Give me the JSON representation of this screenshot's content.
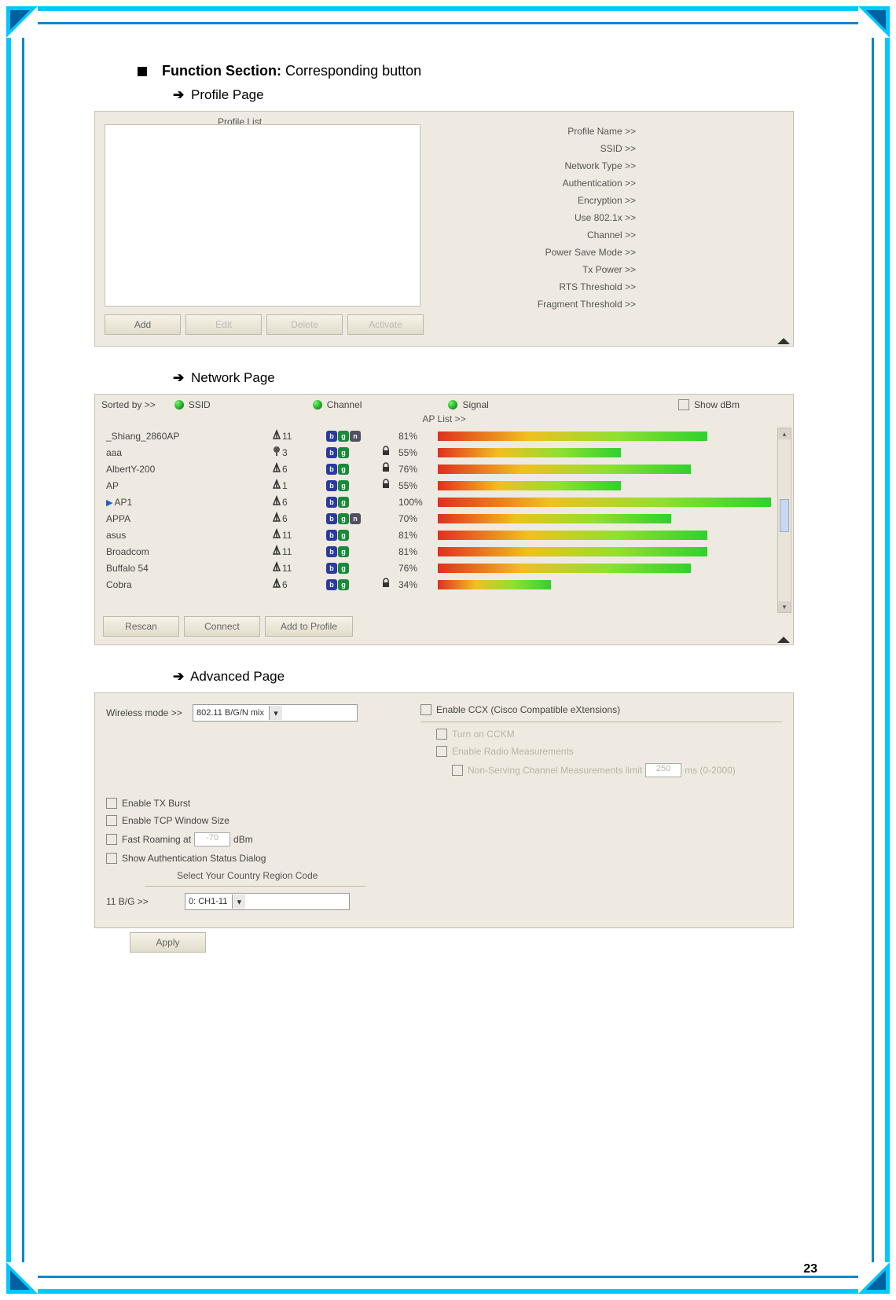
{
  "heading": {
    "label": "Function Section:",
    "desc": "Corresponding button"
  },
  "profile": {
    "title": "Profile Page",
    "list_title": "Profile List",
    "buttons": {
      "add": "Add",
      "edit": "Edit",
      "delete": "Delete",
      "activate": "Activate"
    },
    "props": [
      "Profile Name >>",
      "SSID >>",
      "Network Type >>",
      "Authentication >>",
      "Encryption >>",
      "Use 802.1x >>",
      "Channel >>",
      "Power Save Mode >>",
      "Tx Power >>",
      "RTS Threshold >>",
      "Fragment Threshold >>"
    ]
  },
  "network": {
    "title": "Network Page",
    "sorted_by": "Sorted by >>",
    "ssid": "SSID",
    "channel": "Channel",
    "signal": "Signal",
    "show_dbm": "Show dBm",
    "aplist": "AP List >>",
    "buttons": {
      "rescan": "Rescan",
      "connect": "Connect",
      "add": "Add to Profile"
    },
    "rows": [
      {
        "ssid": "_Shiang_2860AP",
        "ch": 11,
        "modes": [
          "b",
          "g",
          "n"
        ],
        "lock": false,
        "signal": 81,
        "connected": false
      },
      {
        "ssid": "aaa",
        "ch": 3,
        "modes": [
          "b",
          "g"
        ],
        "lock": true,
        "signal": 55,
        "connected": false,
        "altIcon": true
      },
      {
        "ssid": "AlbertY-200",
        "ch": 6,
        "modes": [
          "b",
          "g"
        ],
        "lock": true,
        "signal": 76,
        "connected": false
      },
      {
        "ssid": "AP",
        "ch": 1,
        "modes": [
          "b",
          "g"
        ],
        "lock": true,
        "signal": 55,
        "connected": false
      },
      {
        "ssid": "AP1",
        "ch": 6,
        "modes": [
          "b",
          "g"
        ],
        "lock": false,
        "signal": 100,
        "connected": true
      },
      {
        "ssid": "APPA",
        "ch": 6,
        "modes": [
          "b",
          "g",
          "n"
        ],
        "lock": false,
        "signal": 70,
        "connected": false
      },
      {
        "ssid": "asus",
        "ch": 11,
        "modes": [
          "b",
          "g"
        ],
        "lock": false,
        "signal": 81,
        "connected": false
      },
      {
        "ssid": "Broadcom",
        "ch": 11,
        "modes": [
          "b",
          "g"
        ],
        "lock": false,
        "signal": 81,
        "connected": false
      },
      {
        "ssid": "Buffalo 54",
        "ch": 11,
        "modes": [
          "b",
          "g"
        ],
        "lock": false,
        "signal": 76,
        "connected": false
      },
      {
        "ssid": "Cobra",
        "ch": 6,
        "modes": [
          "b",
          "g"
        ],
        "lock": true,
        "signal": 34,
        "connected": false
      }
    ]
  },
  "advanced": {
    "title": "Advanced Page",
    "wireless_mode_label": "Wireless mode >>",
    "wireless_mode_value": "802.11 B/G/N mix",
    "ccx_label": "Enable CCX (Cisco Compatible eXtensions)",
    "ccka": "Turn on CCKM",
    "radio": "Enable Radio Measurements",
    "nonserv": "Non-Serving Channel Measurements limit",
    "nonserv_val": "250",
    "nonserv_unit": "ms (0-2000)",
    "txburst": "Enable TX Burst",
    "tcpwin": "Enable TCP Window Size",
    "fastroam": "Fast Roaming at",
    "fastroam_val": "-70",
    "fastroam_unit": "dBm",
    "authdlg": "Show Authentication Status Dialog",
    "region_title": "Select Your Country Region Code",
    "bg_label": "11 B/G >>",
    "bg_value": "0: CH1-11",
    "apply": "Apply"
  },
  "page_number": "23"
}
